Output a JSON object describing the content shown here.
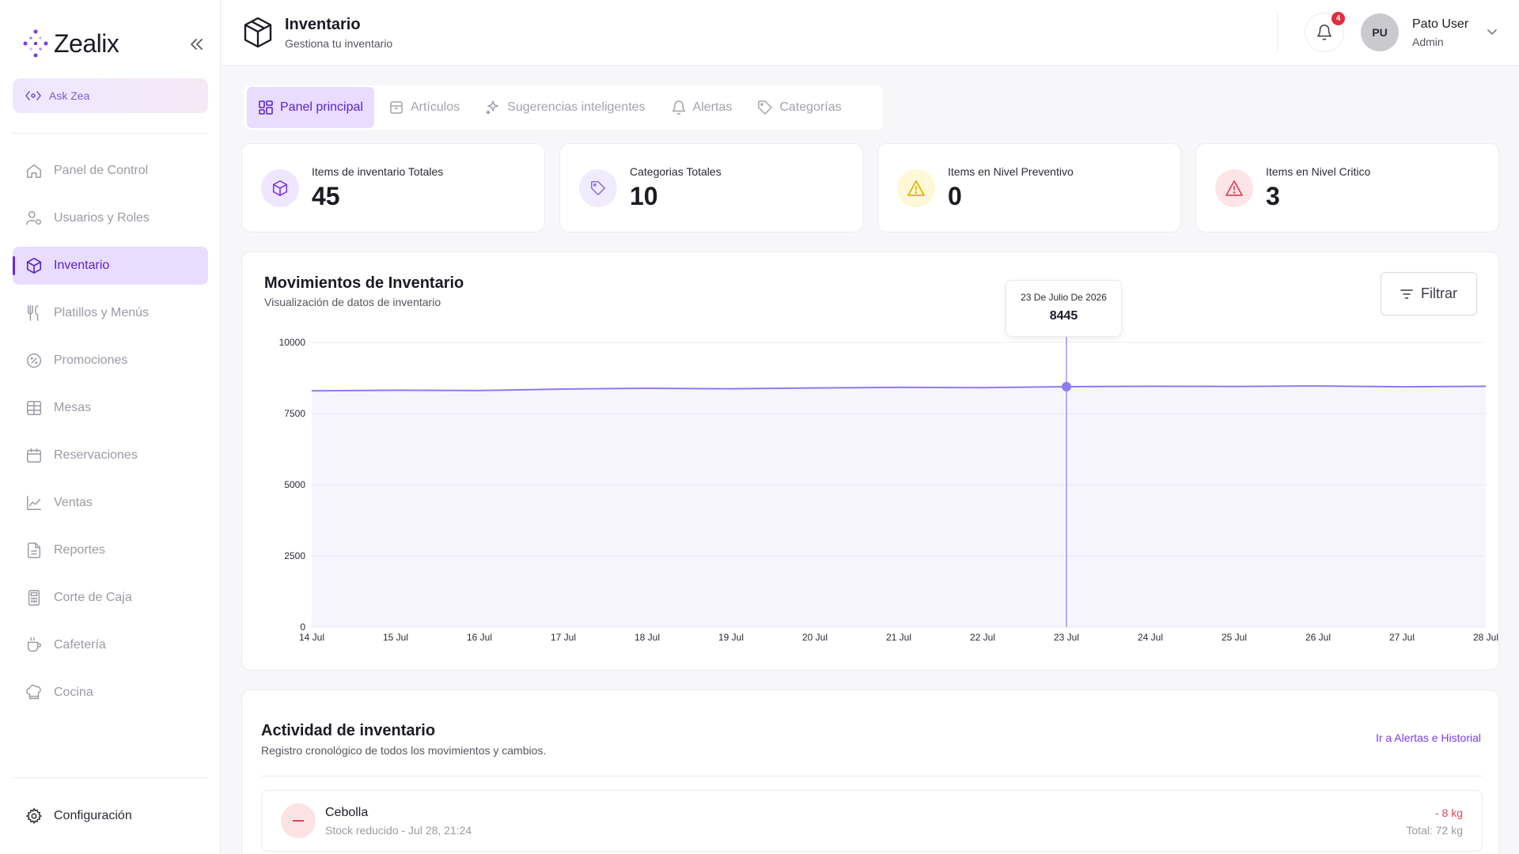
{
  "sidebar": {
    "brand": "Zealix",
    "ask_label": "Ask Zea",
    "items": [
      {
        "label": "Panel de Control",
        "icon": "home-icon"
      },
      {
        "label": "Usuarios y Roles",
        "icon": "users-icon"
      },
      {
        "label": "Inventario",
        "icon": "box-icon",
        "active": true
      },
      {
        "label": "Platillos y Menús",
        "icon": "utensils-icon"
      },
      {
        "label": "Promociones",
        "icon": "percent-badge-icon"
      },
      {
        "label": "Mesas",
        "icon": "grid-table-icon"
      },
      {
        "label": "Reservaciones",
        "icon": "calendar-icon"
      },
      {
        "label": "Ventas",
        "icon": "line-chart-icon"
      },
      {
        "label": "Reportes",
        "icon": "file-text-icon"
      },
      {
        "label": "Corte de Caja",
        "icon": "calculator-icon"
      },
      {
        "label": "Cafetería",
        "icon": "coffee-icon"
      },
      {
        "label": "Cocina",
        "icon": "chef-hat-icon"
      }
    ],
    "config_label": "Configuración"
  },
  "header": {
    "title": "Inventario",
    "subtitle": "Gestiona tu inventario",
    "notifications": "4",
    "avatar_initials": "PU",
    "user_name": "Pato User",
    "user_role": "Admin"
  },
  "tabs": [
    {
      "label": "Panel principal",
      "active": true
    },
    {
      "label": "Artículos"
    },
    {
      "label": "Sugerencias inteligentes"
    },
    {
      "label": "Alertas"
    },
    {
      "label": "Categorías"
    }
  ],
  "stats": [
    {
      "label": "Items de inventario Totales",
      "value": "45",
      "color": "#7c3aed",
      "bg": "#efe7ff",
      "icon": "box-icon"
    },
    {
      "label": "Categorias Totales",
      "value": "10",
      "color": "#8b6fe0",
      "bg": "#f1ecfd",
      "icon": "tag-icon"
    },
    {
      "label": "Items en Nivel Preventivo",
      "value": "0",
      "color": "#e0b100",
      "bg": "#fff8d6",
      "icon": "warning-triangle-icon"
    },
    {
      "label": "Items en Nivel Critico",
      "value": "3",
      "color": "#e0435b",
      "bg": "#fde4e7",
      "icon": "alert-triangle-icon"
    }
  ],
  "chart": {
    "title": "Movimientos de Inventario",
    "subtitle": "Visualización de datos de inventario",
    "filter_label": "Filtrar",
    "tooltip_date": "23 De Julio De 2026",
    "tooltip_value": "8445"
  },
  "chart_data": {
    "type": "area",
    "x": [
      "14 Jul",
      "15 Jul",
      "16 Jul",
      "17 Jul",
      "18 Jul",
      "19 Jul",
      "20 Jul",
      "21 Jul",
      "22 Jul",
      "23 Jul",
      "24 Jul",
      "25 Jul",
      "26 Jul",
      "27 Jul",
      "28 Jul"
    ],
    "values": [
      8300,
      8320,
      8310,
      8360,
      8390,
      8370,
      8400,
      8420,
      8410,
      8445,
      8460,
      8450,
      8470,
      8440,
      8460
    ],
    "ylim": [
      0,
      10000
    ],
    "yticks": [
      0,
      2500,
      5000,
      7500,
      10000
    ],
    "highlight_index": 9,
    "grid": true,
    "color": "#8b7cf0"
  },
  "activity": {
    "title": "Actividad de inventario",
    "subtitle": "Registro cronológico de todos los movimientos y cambios.",
    "link": "Ir a Alertas e Historial",
    "rows": [
      {
        "name": "Cebolla",
        "desc": "Stock reducido - Jul 28, 21:24",
        "delta": "- 8 kg",
        "total": "Total: 72 kg"
      }
    ]
  }
}
